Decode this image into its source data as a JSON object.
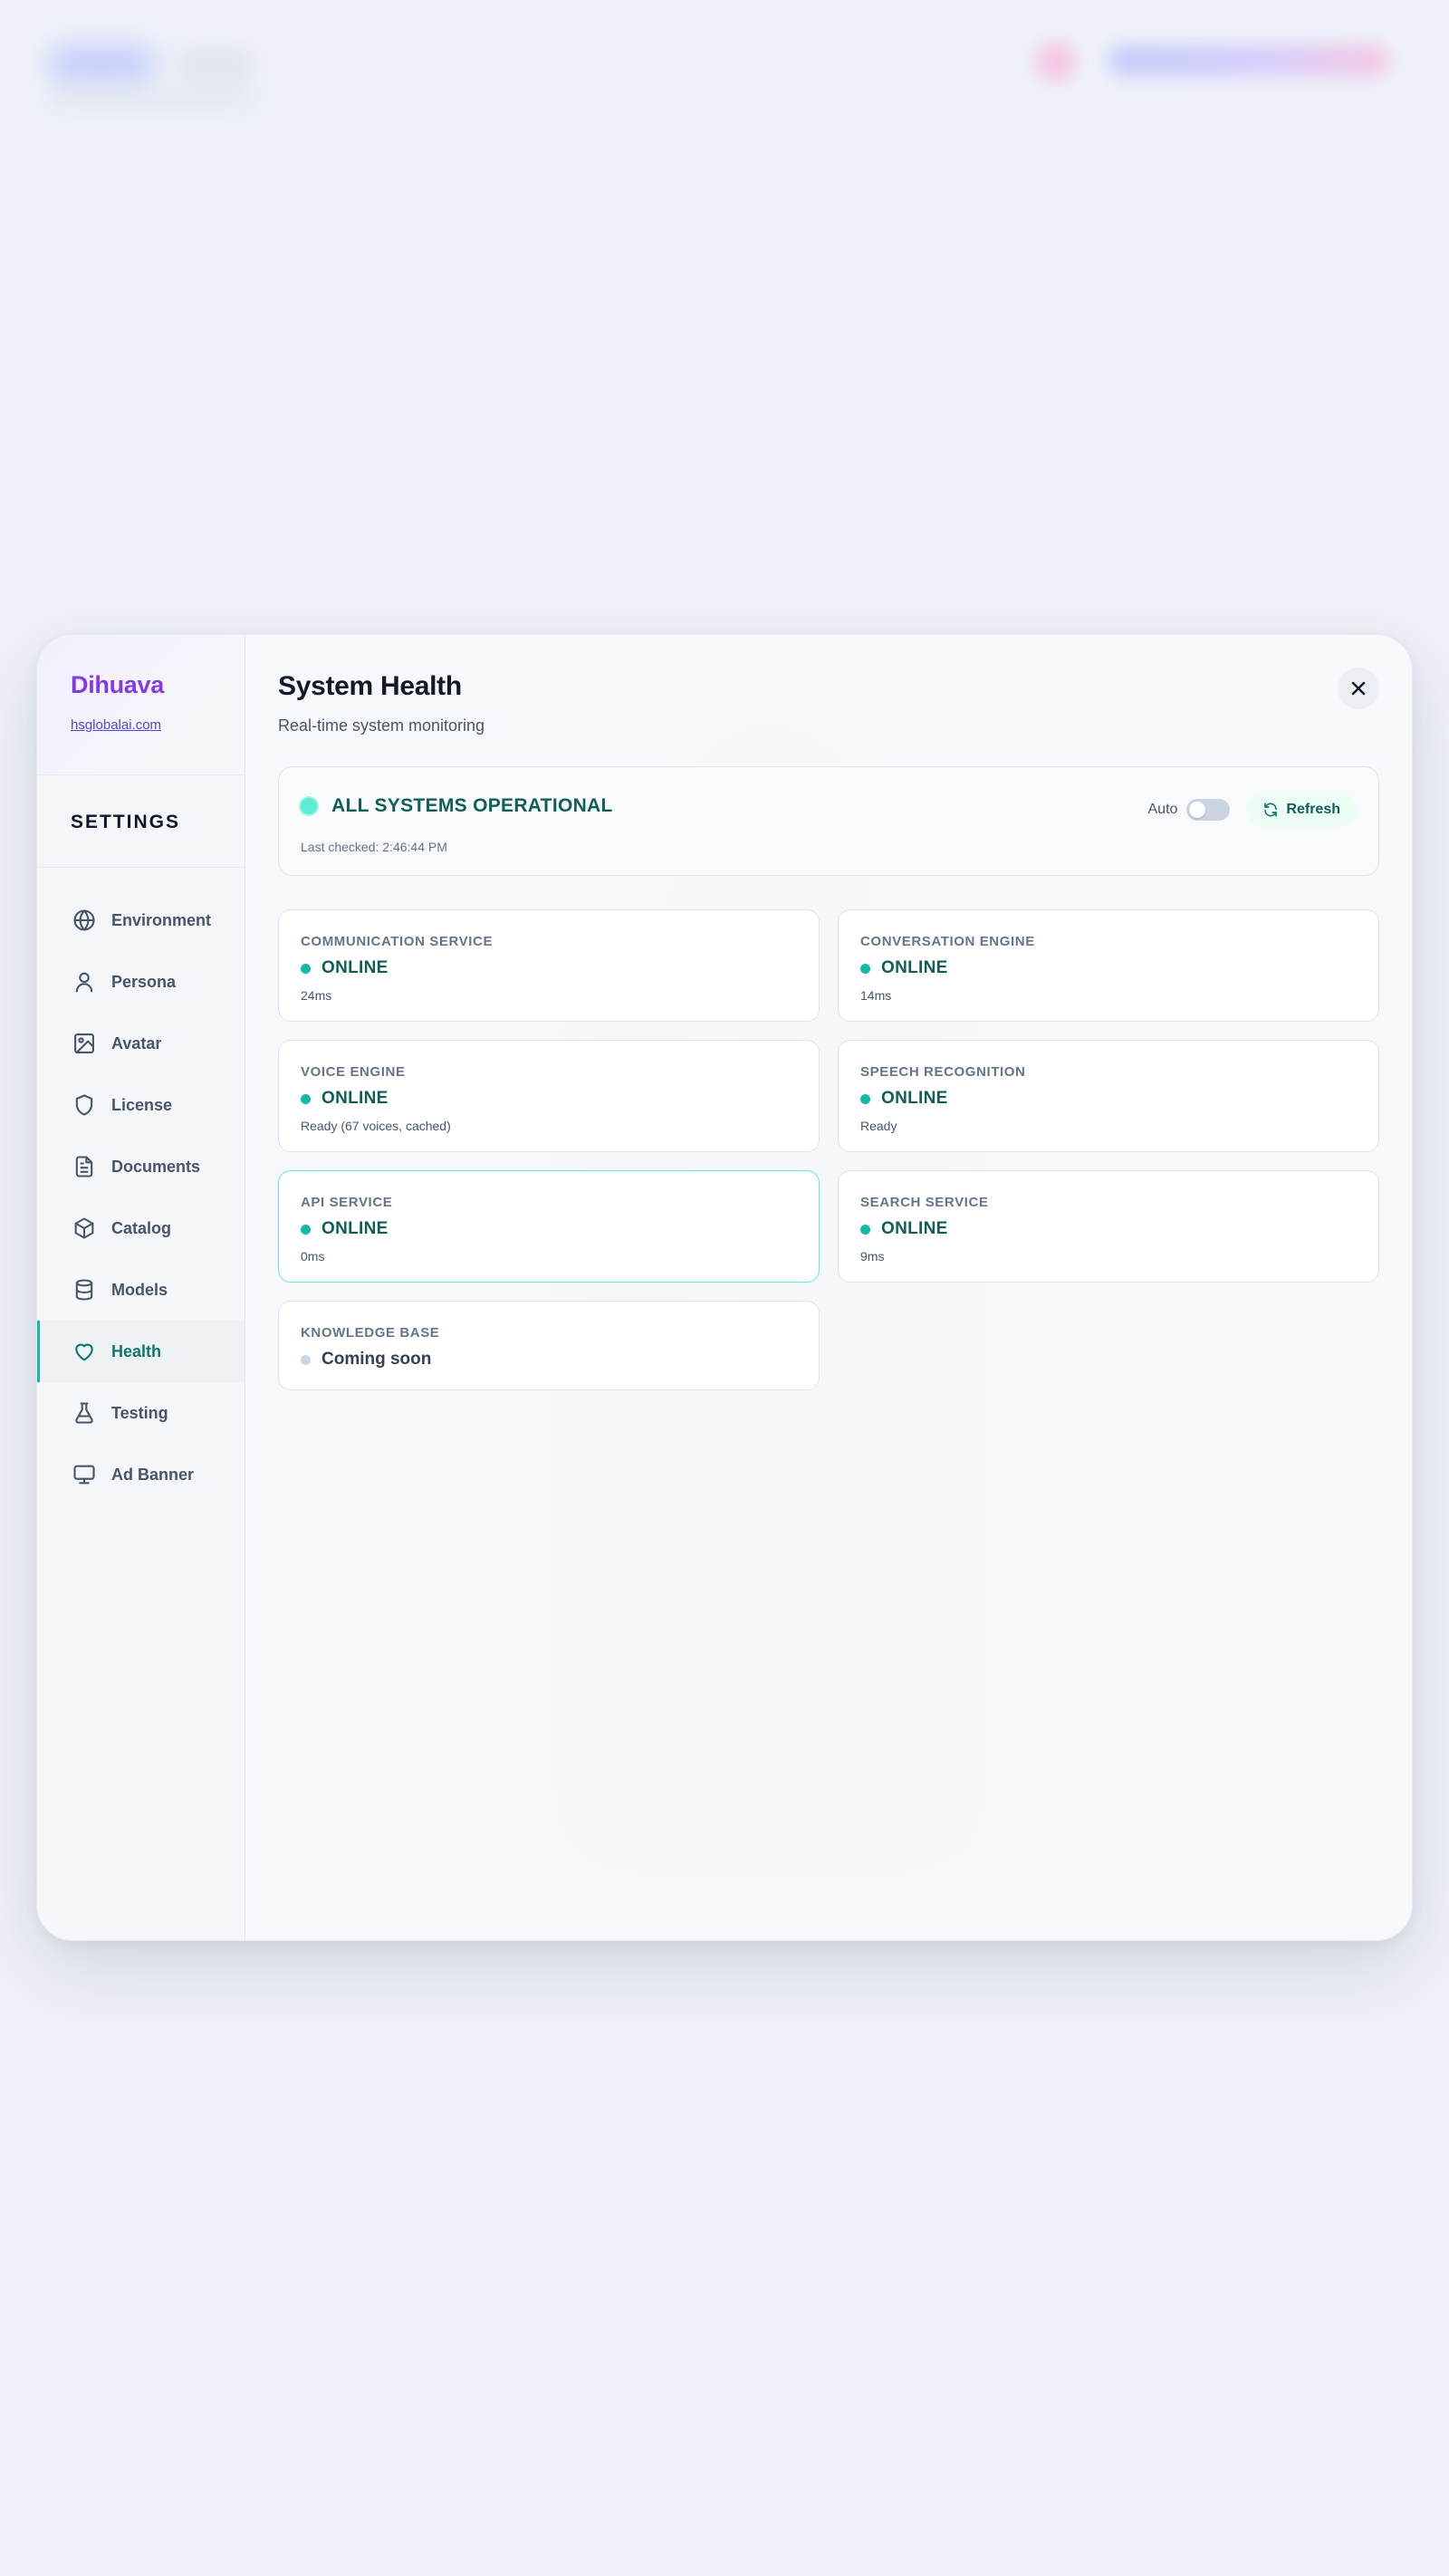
{
  "brand": {
    "name": "Dihuava",
    "link": "hsglobalai.com"
  },
  "sidebar": {
    "heading": "SETTINGS",
    "items": [
      {
        "label": "Environment",
        "icon": "globe-icon"
      },
      {
        "label": "Persona",
        "icon": "user-icon"
      },
      {
        "label": "Avatar",
        "icon": "image-icon"
      },
      {
        "label": "License",
        "icon": "shield-icon"
      },
      {
        "label": "Documents",
        "icon": "document-icon"
      },
      {
        "label": "Catalog",
        "icon": "box-icon"
      },
      {
        "label": "Models",
        "icon": "database-icon"
      },
      {
        "label": "Health",
        "icon": "heart-icon",
        "active": true
      },
      {
        "label": "Testing",
        "icon": "flask-icon"
      },
      {
        "label": "Ad Banner",
        "icon": "monitor-icon"
      }
    ]
  },
  "header": {
    "title": "System Health",
    "subtitle": "Real-time system monitoring"
  },
  "overall": {
    "status": "ALL SYSTEMS OPERATIONAL",
    "last_checked": "Last checked: 2:46:44 PM",
    "auto_label": "Auto",
    "auto_enabled": false,
    "refresh_label": "Refresh"
  },
  "services": [
    {
      "name": "COMMUNICATION SERVICE",
      "status": "ONLINE",
      "detail": "24ms"
    },
    {
      "name": "CONVERSATION ENGINE",
      "status": "ONLINE",
      "detail": "14ms"
    },
    {
      "name": "VOICE ENGINE",
      "status": "ONLINE",
      "detail": "Ready (67 voices, cached)"
    },
    {
      "name": "SPEECH RECOGNITION",
      "status": "ONLINE",
      "detail": "Ready"
    },
    {
      "name": "API SERVICE",
      "status": "ONLINE",
      "detail": "0ms"
    },
    {
      "name": "SEARCH SERVICE",
      "status": "ONLINE",
      "detail": "9ms"
    },
    {
      "name": "KNOWLEDGE BASE",
      "status": "Coming soon"
    }
  ],
  "colors": {
    "accent": "#14b8a6",
    "online_text": "#115e59",
    "brand": "#7c3aed"
  }
}
